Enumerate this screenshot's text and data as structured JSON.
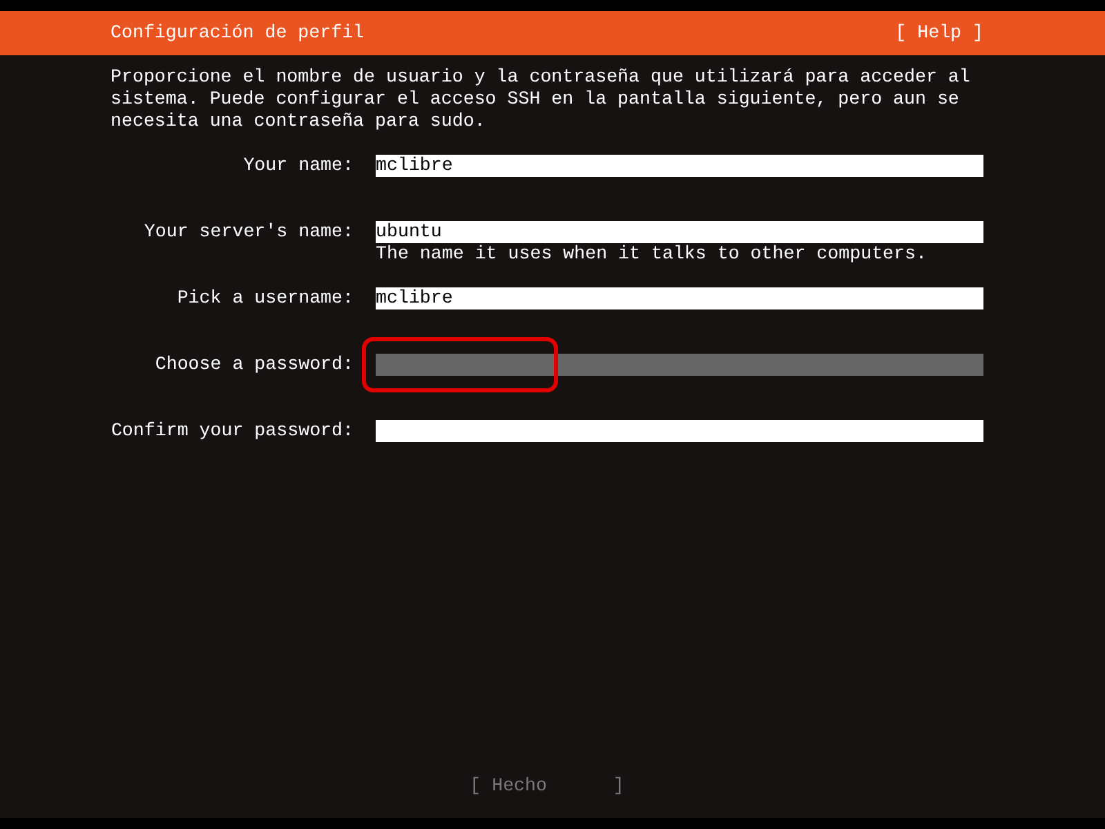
{
  "header": {
    "title": "Configuración de perfil",
    "help": "[ Help ]"
  },
  "intro": "Proporcione el nombre de usuario y la contraseña que utilizará para acceder al sistema. Puede configurar el acceso SSH en la pantalla siguiente, pero aun se necesita una contraseña para sudo.",
  "fields": [
    {
      "label": "Your name:",
      "value": "mclibre",
      "focused": false,
      "highlighted": false
    },
    {
      "label": "Your server's name:",
      "value": "ubuntu",
      "hint": "The name it uses when it talks to other computers.",
      "focused": false,
      "highlighted": false
    },
    {
      "label": "Pick a username:",
      "value": "mclibre",
      "focused": false,
      "highlighted": false
    },
    {
      "label": "Choose a password:",
      "focused": true,
      "highlighted": true
    },
    {
      "label": "Confirm your password:",
      "focused": false,
      "highlighted": false
    }
  ],
  "done_button": {
    "label": "[ Hecho      ]",
    "disabled": true
  }
}
